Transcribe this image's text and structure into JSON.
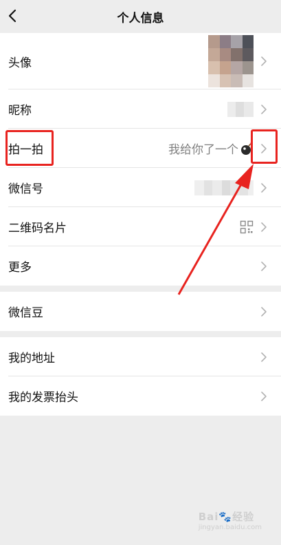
{
  "header": {
    "title": "个人信息",
    "back_icon": "chevron-left-icon"
  },
  "groups": [
    {
      "items": [
        {
          "label": "头像",
          "value": "",
          "icon": "chevron-right-icon"
        },
        {
          "label": "昵称",
          "value": "",
          "icon": "chevron-right-icon"
        },
        {
          "label": "拍一拍",
          "value": "我给你了一个",
          "emoji": "bomb-icon",
          "icon": "chevron-right-icon"
        },
        {
          "label": "微信号",
          "value": "",
          "icon": "chevron-right-icon"
        },
        {
          "label": "二维码名片",
          "value": "",
          "trailing_icon": "qr-code-icon",
          "icon": "chevron-right-icon"
        },
        {
          "label": "更多",
          "value": "",
          "icon": "chevron-right-icon"
        }
      ]
    },
    {
      "items": [
        {
          "label": "微信豆",
          "icon": "chevron-right-icon"
        }
      ]
    },
    {
      "items": [
        {
          "label": "我的地址",
          "icon": "chevron-right-icon"
        },
        {
          "label": "我的发票抬头",
          "icon": "chevron-right-icon"
        }
      ]
    }
  ],
  "annotation": {
    "color": "#e8231f"
  },
  "watermark": {
    "brand": "Bai",
    "suffix": "经验",
    "domain": "jingyan.baidu.com"
  },
  "colors": {
    "background": "#ededed",
    "card": "#ffffff",
    "divider": "#e5e5e5",
    "secondary_text": "#7f7f7f",
    "chevron": "#b2b2b2"
  }
}
